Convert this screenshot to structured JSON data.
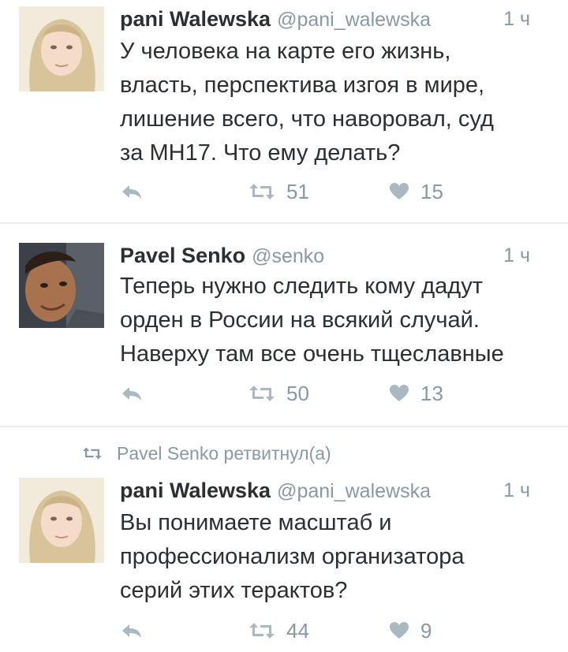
{
  "colors": {
    "text": "#292f33",
    "muted": "#8899a6",
    "divider": "#e6ecf0",
    "icon": "#aab8c2"
  },
  "tweets": [
    {
      "name": "pani Walewska",
      "handle": "@pani_walewska",
      "time": "1 ч",
      "text": "У человека на карте его жизнь,\nвласть, перспектива изгоя в мире,\nлишение всего, что наворовал, суд\nза МН17. Что ему делать?",
      "retweets": "51",
      "likes": "15",
      "avatar_icon": "woman-avatar"
    },
    {
      "name": "Pavel Senko",
      "handle": "@senko",
      "time": "1 ч",
      "text": "Теперь нужно следить кому дадут\nорден в России на всякий случай.\nНаверху там все очень тщеславные",
      "retweets": "50",
      "likes": "13",
      "avatar_icon": "man-avatar"
    },
    {
      "retweet_context": "Pavel Senko ретвитнул(а)",
      "name": "pani Walewska",
      "handle": "@pani_walewska",
      "time": "1 ч",
      "text": "Вы понимаете масштаб и\nпрофессионализм организатора\nсерий этих терактов?",
      "retweets": "44",
      "likes": "9",
      "avatar_icon": "woman-avatar"
    }
  ],
  "icons": {
    "reply": "reply-icon",
    "retweet": "retweet-icon",
    "like": "heart-icon"
  }
}
